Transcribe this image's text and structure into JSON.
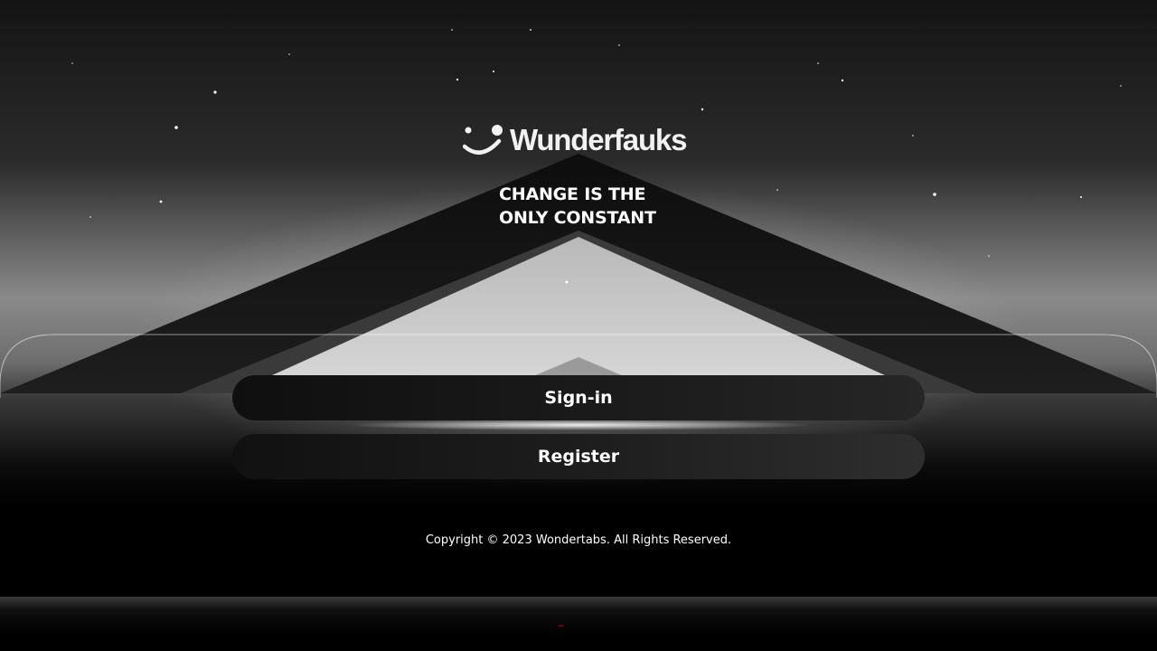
{
  "app": {
    "brand_name": "Wunderfauks",
    "logo_icon": "smiley-logo-icon"
  },
  "hero": {
    "tagline_line1": "CHANGE IS THE",
    "tagline_line2": "ONLY CONSTANT"
  },
  "actions": {
    "signin_label": "Sign-in",
    "register_label": "Register"
  },
  "footer": {
    "copyright": "Copyright © 2023 Wondertabs. All Rights Reserved."
  },
  "colors": {
    "text": "#ffffff",
    "button_bg": "#1a1a1a",
    "background": "#000000"
  }
}
